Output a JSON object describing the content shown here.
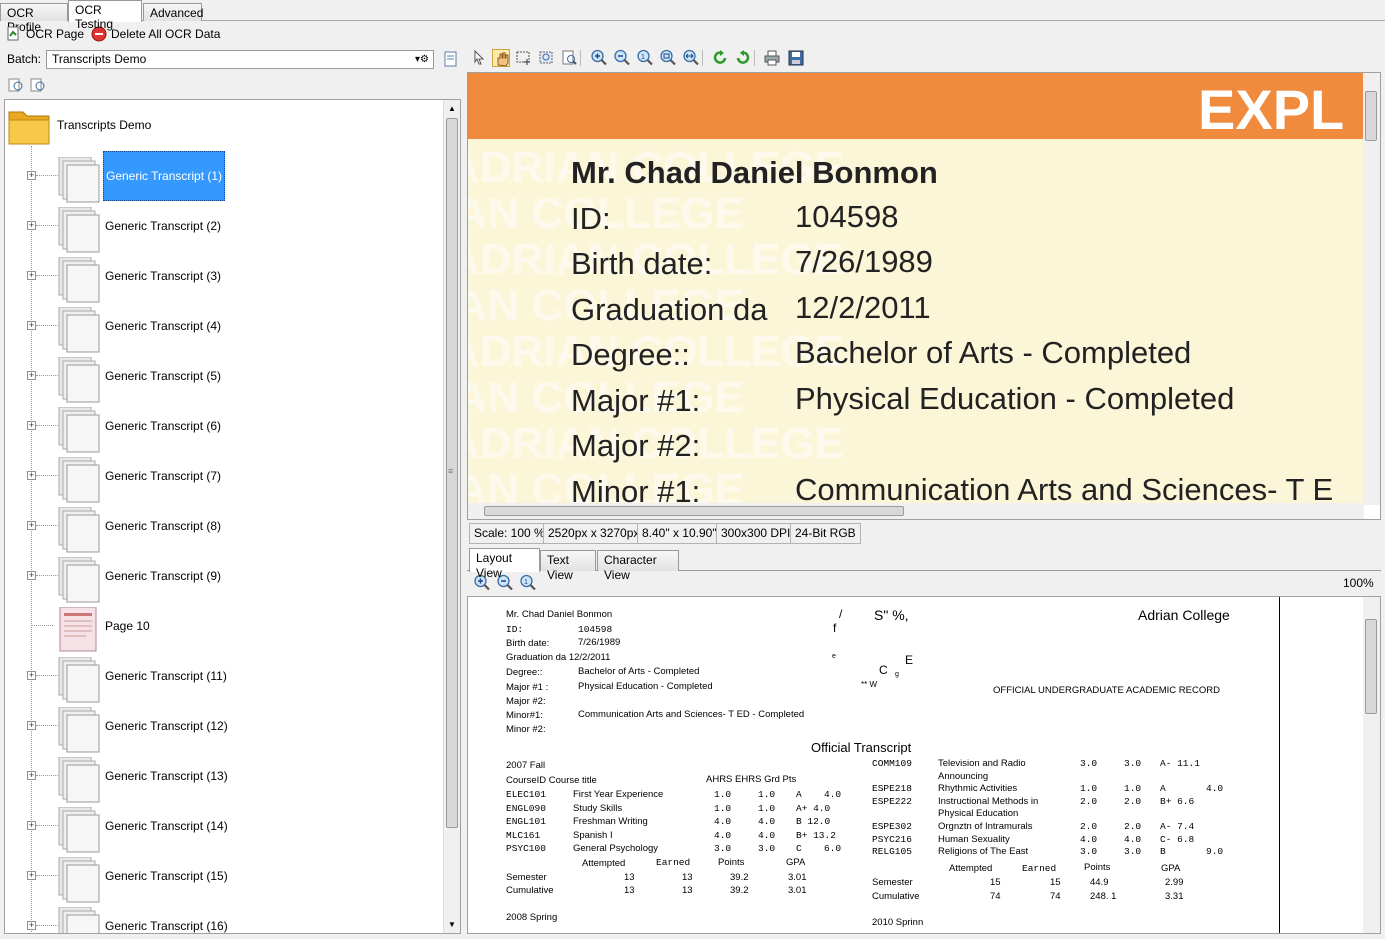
{
  "tabs": [
    "OCR Profile",
    "OCR Testing",
    "Advanced"
  ],
  "toolbar": {
    "ocr_page": "OCR Page",
    "delete_all": "Delete All OCR Data"
  },
  "batch": {
    "label": "Batch:",
    "value": "Transcripts Demo"
  },
  "tree": {
    "root": "Transcripts Demo",
    "items": [
      "Generic Transcript (1)",
      "Generic Transcript (2)",
      "Generic Transcript (3)",
      "Generic Transcript (4)",
      "Generic Transcript (5)",
      "Generic Transcript (6)",
      "Generic Transcript (7)",
      "Generic Transcript (8)",
      "Generic Transcript (9)",
      "Page 10",
      "Generic Transcript (11)",
      "Generic Transcript (12)",
      "Generic Transcript (13)",
      "Generic Transcript (14)",
      "Generic Transcript (15)",
      "Generic Transcript (16)"
    ]
  },
  "document": {
    "banner": "EXPL",
    "lines": [
      {
        "label": "Mr. Chad Daniel Bonmon",
        "value": ""
      },
      {
        "label": "ID:",
        "value": "104598"
      },
      {
        "label": "Birth date:",
        "value": "7/26/1989"
      },
      {
        "label": "Graduation da",
        "value": "12/2/2011"
      },
      {
        "label": "Degree::",
        "value": "Bachelor of Arts - Completed"
      },
      {
        "label": "Major #1:",
        "value": "Physical Education - Completed"
      },
      {
        "label": "Major #2:",
        "value": ""
      },
      {
        "label": "Minor #1:",
        "value": "Communication Arts and Sciences- T E"
      }
    ],
    "watermark": "ADRIAN COLLEGE"
  },
  "status": {
    "scale": "Scale: 100 %",
    "pixels": "2520px x 3270px",
    "inches": "8.40\" x 10.90\"",
    "dpi": "300x300 DPI",
    "bits": "24-Bit RGB"
  },
  "view_tabs": [
    "Layout View",
    "Text View",
    "Character View"
  ],
  "layout_zoom": "100%",
  "layout": {
    "name": "Mr. Chad Daniel Bonmon",
    "id_label": "ID:",
    "id": "104598",
    "birth_label": "Birth date:",
    "birth": "7/26/1989",
    "grad": "Graduation da 12/2/2011",
    "degree_label": "Degree::",
    "degree": "Bachelor of Arts - Completed",
    "major1_label": "Major #1 :",
    "major1": "Physical Education - Completed",
    "major2_label": "Major #2:",
    "minor1_label": "Minor#1:",
    "minor1": "Communication Arts and Sciences- T ED - Completed",
    "minor2_label": "Minor #2:",
    "college": "Adrian College",
    "record": "OFFICIAL UNDERGRADUATE ACADEMIC RECORD",
    "noise": [
      "/",
      "f",
      "S\" %,",
      "e",
      "C",
      "E",
      "g",
      "** W"
    ],
    "official": "Official Transcript",
    "term1": "2007 Fall",
    "course_header": "CourseID Course title",
    "grade_header": "AHRS EHRS Grd Pts",
    "courses_left": [
      [
        "ELEC101",
        "First Year Experience",
        "1.0",
        "1.0",
        "A",
        "4.0"
      ],
      [
        "ENGL090",
        "Study Skills",
        "1.0",
        "1.0",
        "A+ 4.0",
        ""
      ],
      [
        "ENGL101",
        "Freshman Writing",
        "4.0",
        "4.0",
        "B 12.0",
        ""
      ],
      [
        "MLC161",
        "Spanish I",
        "4.0",
        "4.0",
        "B+ 13.2",
        ""
      ],
      [
        "PSYC100",
        "General Psychology",
        "3.0",
        "3.0",
        "C",
        "6.0"
      ]
    ],
    "totals_header": [
      "Attempted",
      "Earned",
      "Points",
      "GPA"
    ],
    "semester_left": [
      "Semester",
      "13",
      "13",
      "39.2",
      "3.01"
    ],
    "cumulative_left": [
      "Cumulative",
      "13",
      "13",
      "39.2",
      "3.01"
    ],
    "term2": "2008 Spring",
    "courses_right": [
      [
        "COMM109",
        "Television and Radio",
        "3.0",
        "3.0",
        "A- 11.1",
        ""
      ],
      [
        "",
        "Announcing",
        "",
        "",
        "",
        ""
      ],
      [
        "ESPE218",
        "Rhythmic Activities",
        "1.0",
        "1.0",
        "A",
        "4.0"
      ],
      [
        "ESPE222",
        "Instructional Methods in",
        "2.0",
        "2.0",
        "B+ 6.6",
        ""
      ],
      [
        "",
        "Physical Education",
        "",
        "",
        "",
        ""
      ],
      [
        "ESPE302",
        "Orgnztn of Intramurals",
        "2.0",
        "2.0",
        "A- 7.4",
        ""
      ],
      [
        "PSYC216",
        "Human Sexuality",
        "4.0",
        "4.0",
        "C- 6.8",
        ""
      ],
      [
        "RELG105",
        "Religions of The East",
        "3.0",
        "3.0",
        "B",
        "9.0"
      ]
    ],
    "semester_right": [
      "Semester",
      "15",
      "15",
      "44.9",
      "2.99"
    ],
    "cumulative_right": [
      "Cumulative",
      "74",
      "74",
      "248. 1",
      "3.31"
    ],
    "term3": "2010 Sprinn"
  }
}
